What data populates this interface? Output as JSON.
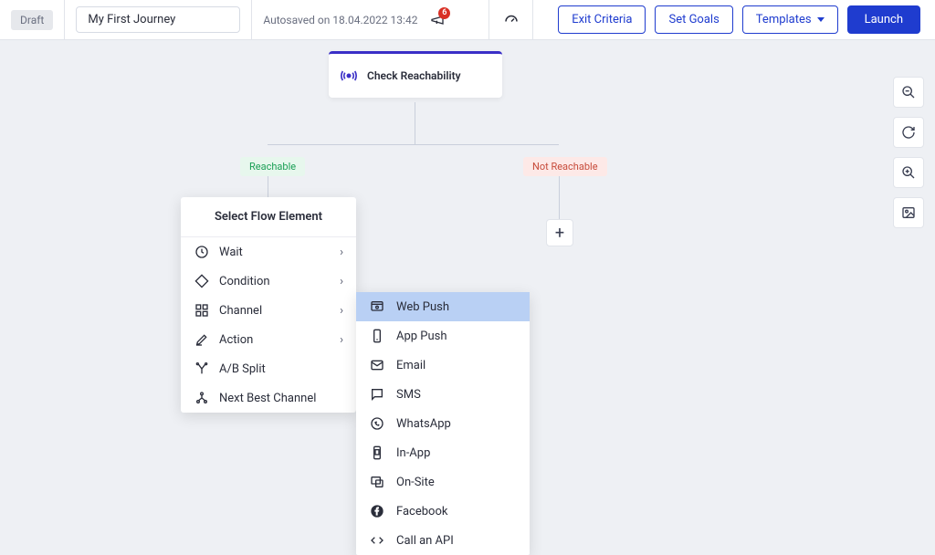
{
  "header": {
    "draft_label": "Draft",
    "journey_name": "My First Journey",
    "autosave_text": "Autosaved on 18.04.2022 13:42",
    "notification_count": "6",
    "exit_criteria": "Exit Criteria",
    "set_goals": "Set Goals",
    "templates": "Templates",
    "launch": "Launch"
  },
  "canvas": {
    "check_node_label": "Check Reachability",
    "reachable_tag": "Reachable",
    "not_reachable_tag": "Not Reachable",
    "add_button": "+"
  },
  "flow_panel": {
    "title": "Select Flow Element",
    "items": [
      {
        "label": "Wait",
        "has_submenu": true,
        "icon": "clock"
      },
      {
        "label": "Condition",
        "has_submenu": true,
        "icon": "diamond"
      },
      {
        "label": "Channel",
        "has_submenu": true,
        "icon": "grid"
      },
      {
        "label": "Action",
        "has_submenu": true,
        "icon": "pencil"
      },
      {
        "label": "A/B Split",
        "has_submenu": false,
        "icon": "split"
      },
      {
        "label": "Next Best Channel",
        "has_submenu": false,
        "icon": "network"
      }
    ]
  },
  "channel_panel": {
    "items": [
      {
        "label": "Web Push",
        "icon": "web-push",
        "selected": true
      },
      {
        "label": "App Push",
        "icon": "app-push",
        "selected": false
      },
      {
        "label": "Email",
        "icon": "email",
        "selected": false
      },
      {
        "label": "SMS",
        "icon": "sms",
        "selected": false
      },
      {
        "label": "WhatsApp",
        "icon": "whatsapp",
        "selected": false
      },
      {
        "label": "In-App",
        "icon": "in-app",
        "selected": false
      },
      {
        "label": "On-Site",
        "icon": "on-site",
        "selected": false
      },
      {
        "label": "Facebook",
        "icon": "facebook",
        "selected": false
      },
      {
        "label": "Call an API",
        "icon": "api",
        "selected": false
      }
    ]
  }
}
